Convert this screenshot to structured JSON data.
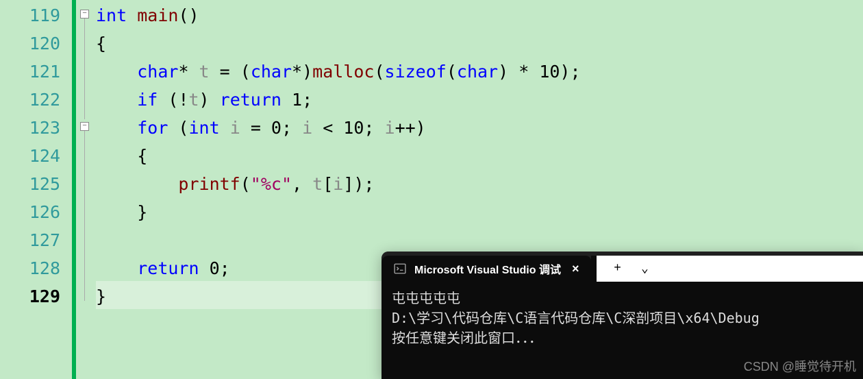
{
  "editor": {
    "line_numbers": [
      "119",
      "120",
      "121",
      "122",
      "123",
      "124",
      "125",
      "126",
      "127",
      "128",
      "129"
    ],
    "active_line_index": 10,
    "code": {
      "l119": {
        "kw1": "int",
        "fn1": "main",
        "rest": "()"
      },
      "l120": {
        "brace": "{"
      },
      "l121": {
        "kw1": "char",
        "star1": "* ",
        "id1": "t",
        "eq": " = (",
        "kw2": "char",
        "star2": "*)",
        "fn1": "malloc",
        "p1": "(",
        "kw3": "sizeof",
        "p2": "(",
        "kw4": "char",
        "p3": ") * 10);"
      },
      "l122": {
        "kw1": "if",
        "p1": " (!",
        "id1": "t",
        "p2": ") ",
        "kw2": "return",
        "p3": " 1;"
      },
      "l123": {
        "kw1": "for",
        "p1": " (",
        "kw2": "int",
        "sp": " ",
        "id1": "i",
        "p2": " = 0; ",
        "id2": "i",
        "p3": " < 10; ",
        "id3": "i",
        "p4": "++)"
      },
      "l124": {
        "brace": "{"
      },
      "l125": {
        "fn1": "printf",
        "p1": "(",
        "str1": "\"%c\"",
        "p2": ", ",
        "id1": "t",
        "p3": "[",
        "id2": "i",
        "p4": "]);"
      },
      "l126": {
        "brace": "}"
      },
      "l127": {
        "empty": ""
      },
      "l128": {
        "kw1": "return",
        "p1": " 0;"
      },
      "l129": {
        "brace": "}"
      }
    }
  },
  "terminal": {
    "tab_title": "Microsoft Visual Studio 调试",
    "close_icon": "×",
    "plus_icon": "+",
    "chevron_icon": "⌄",
    "output_line1": "屯屯屯屯屯",
    "output_line2": "D:\\学习\\代码仓库\\C语言代码仓库\\C深剖项目\\x64\\Debug",
    "output_line3": "按任意键关闭此窗口．．．"
  },
  "watermark": "CSDN @睡觉待开机"
}
